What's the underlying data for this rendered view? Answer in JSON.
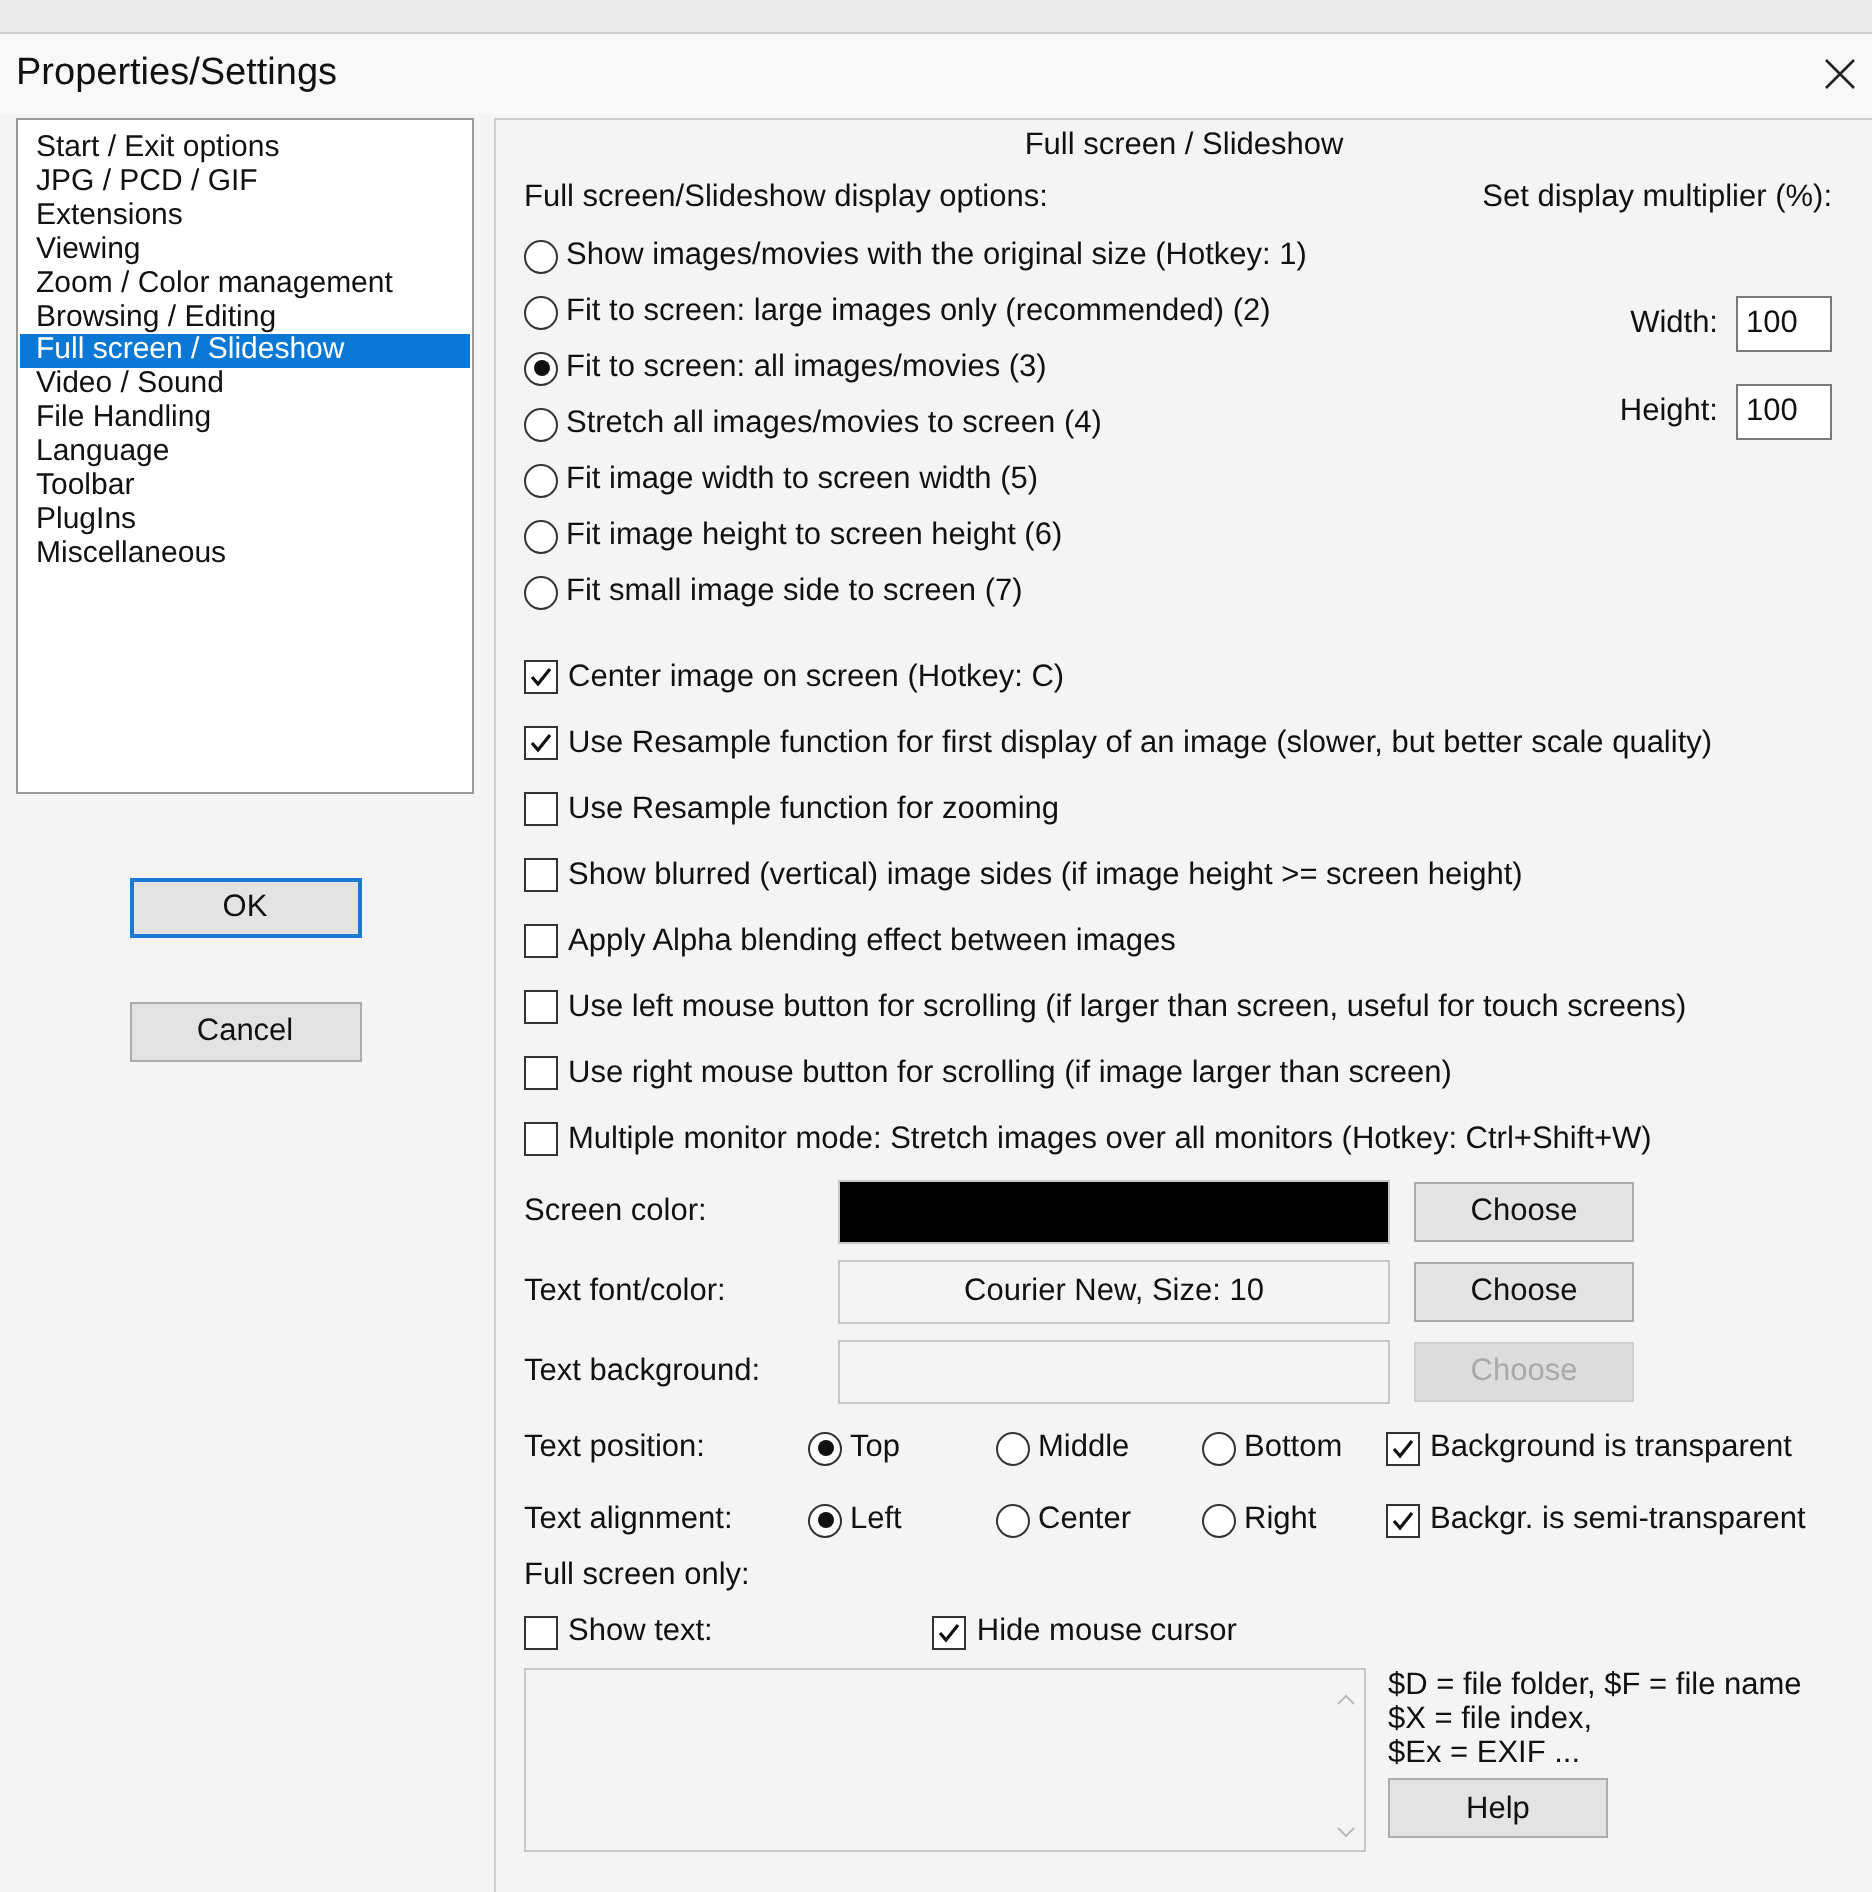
{
  "window": {
    "title": "Properties/Settings"
  },
  "sidebar": {
    "items": [
      {
        "label": "Start / Exit options",
        "selected": false
      },
      {
        "label": "JPG / PCD / GIF",
        "selected": false
      },
      {
        "label": "Extensions",
        "selected": false
      },
      {
        "label": "Viewing",
        "selected": false
      },
      {
        "label": "Zoom / Color management",
        "selected": false
      },
      {
        "label": "Browsing / Editing",
        "selected": false
      },
      {
        "label": "Full screen / Slideshow",
        "selected": true
      },
      {
        "label": "Video / Sound",
        "selected": false
      },
      {
        "label": "File Handling",
        "selected": false
      },
      {
        "label": "Language",
        "selected": false
      },
      {
        "label": "Toolbar",
        "selected": false
      },
      {
        "label": "PlugIns",
        "selected": false
      },
      {
        "label": "Miscellaneous",
        "selected": false
      }
    ]
  },
  "buttons": [
    {
      "label": "OK",
      "default": true
    },
    {
      "label": "Cancel",
      "default": false
    }
  ],
  "panel": {
    "title": "Full screen / Slideshow",
    "display_options": {
      "label": "Full screen/Slideshow display options:",
      "options": [
        {
          "label": "Show images/movies with the original size (Hotkey: 1)",
          "selected": false
        },
        {
          "label": "Fit to screen: large images only (recommended) (2)",
          "selected": false
        },
        {
          "label": "Fit to screen: all images/movies (3)",
          "selected": true
        },
        {
          "label": "Stretch all images/movies to screen (4)",
          "selected": false
        },
        {
          "label": "Fit image width to screen width (5)",
          "selected": false
        },
        {
          "label": "Fit image height to screen height (6)",
          "selected": false
        },
        {
          "label": "Fit small image side to screen (7)",
          "selected": false
        }
      ]
    },
    "multiplier": {
      "label": "Set display multiplier (%):",
      "fields": [
        {
          "label": "Width:",
          "value": "100"
        },
        {
          "label": "Height:",
          "value": "100"
        }
      ]
    },
    "checkboxes": [
      {
        "label": "Center image on screen (Hotkey: C)",
        "checked": true
      },
      {
        "label": "Use Resample function for first display of an image (slower, but better scale quality)",
        "checked": true
      },
      {
        "label": "Use Resample function for zooming",
        "checked": false
      },
      {
        "label": "Show blurred (vertical) image sides (if image height >= screen height)",
        "checked": false
      },
      {
        "label": "Apply Alpha blending effect between images",
        "checked": false
      },
      {
        "label": "Use left mouse button for scrolling (if larger than screen, useful for touch screens)",
        "checked": false
      },
      {
        "label": "Use right mouse button for scrolling (if image larger than screen)",
        "checked": false
      },
      {
        "label": "Multiple monitor mode: Stretch images over all monitors (Hotkey: Ctrl+Shift+W)",
        "checked": false
      }
    ],
    "color_rows": [
      {
        "label": "Screen color:",
        "kind": "swatch",
        "color": "#000000",
        "button": {
          "label": "Choose",
          "disabled": false
        }
      },
      {
        "label": "Text font/color:",
        "kind": "text",
        "value": "Courier New, Size: 10",
        "button": {
          "label": "Choose",
          "disabled": false
        }
      },
      {
        "label": "Text background:",
        "kind": "empty",
        "button": {
          "label": "Choose",
          "disabled": true
        }
      }
    ],
    "text_rows": [
      {
        "label": "Text position:",
        "options": [
          {
            "label": "Top",
            "selected": true
          },
          {
            "label": "Middle",
            "selected": false
          },
          {
            "label": "Bottom",
            "selected": false
          }
        ],
        "checkbox": {
          "label": "Background is transparent",
          "checked": true
        }
      },
      {
        "label": "Text alignment:",
        "options": [
          {
            "label": "Left",
            "selected": true
          },
          {
            "label": "Center",
            "selected": false
          },
          {
            "label": "Right",
            "selected": false
          }
        ],
        "checkbox": {
          "label": "Backgr. is semi-transparent",
          "checked": true
        }
      }
    ],
    "full_screen_only": "Full screen only:",
    "show_text": {
      "label": "Show text:",
      "checked": false
    },
    "hide_cursor": {
      "label": "Hide mouse cursor",
      "checked": true
    },
    "help_lines": [
      "$D = file folder, $F = file name",
      "$X = file index,",
      "$Ex = EXIF ..."
    ],
    "help_button": "Help"
  }
}
